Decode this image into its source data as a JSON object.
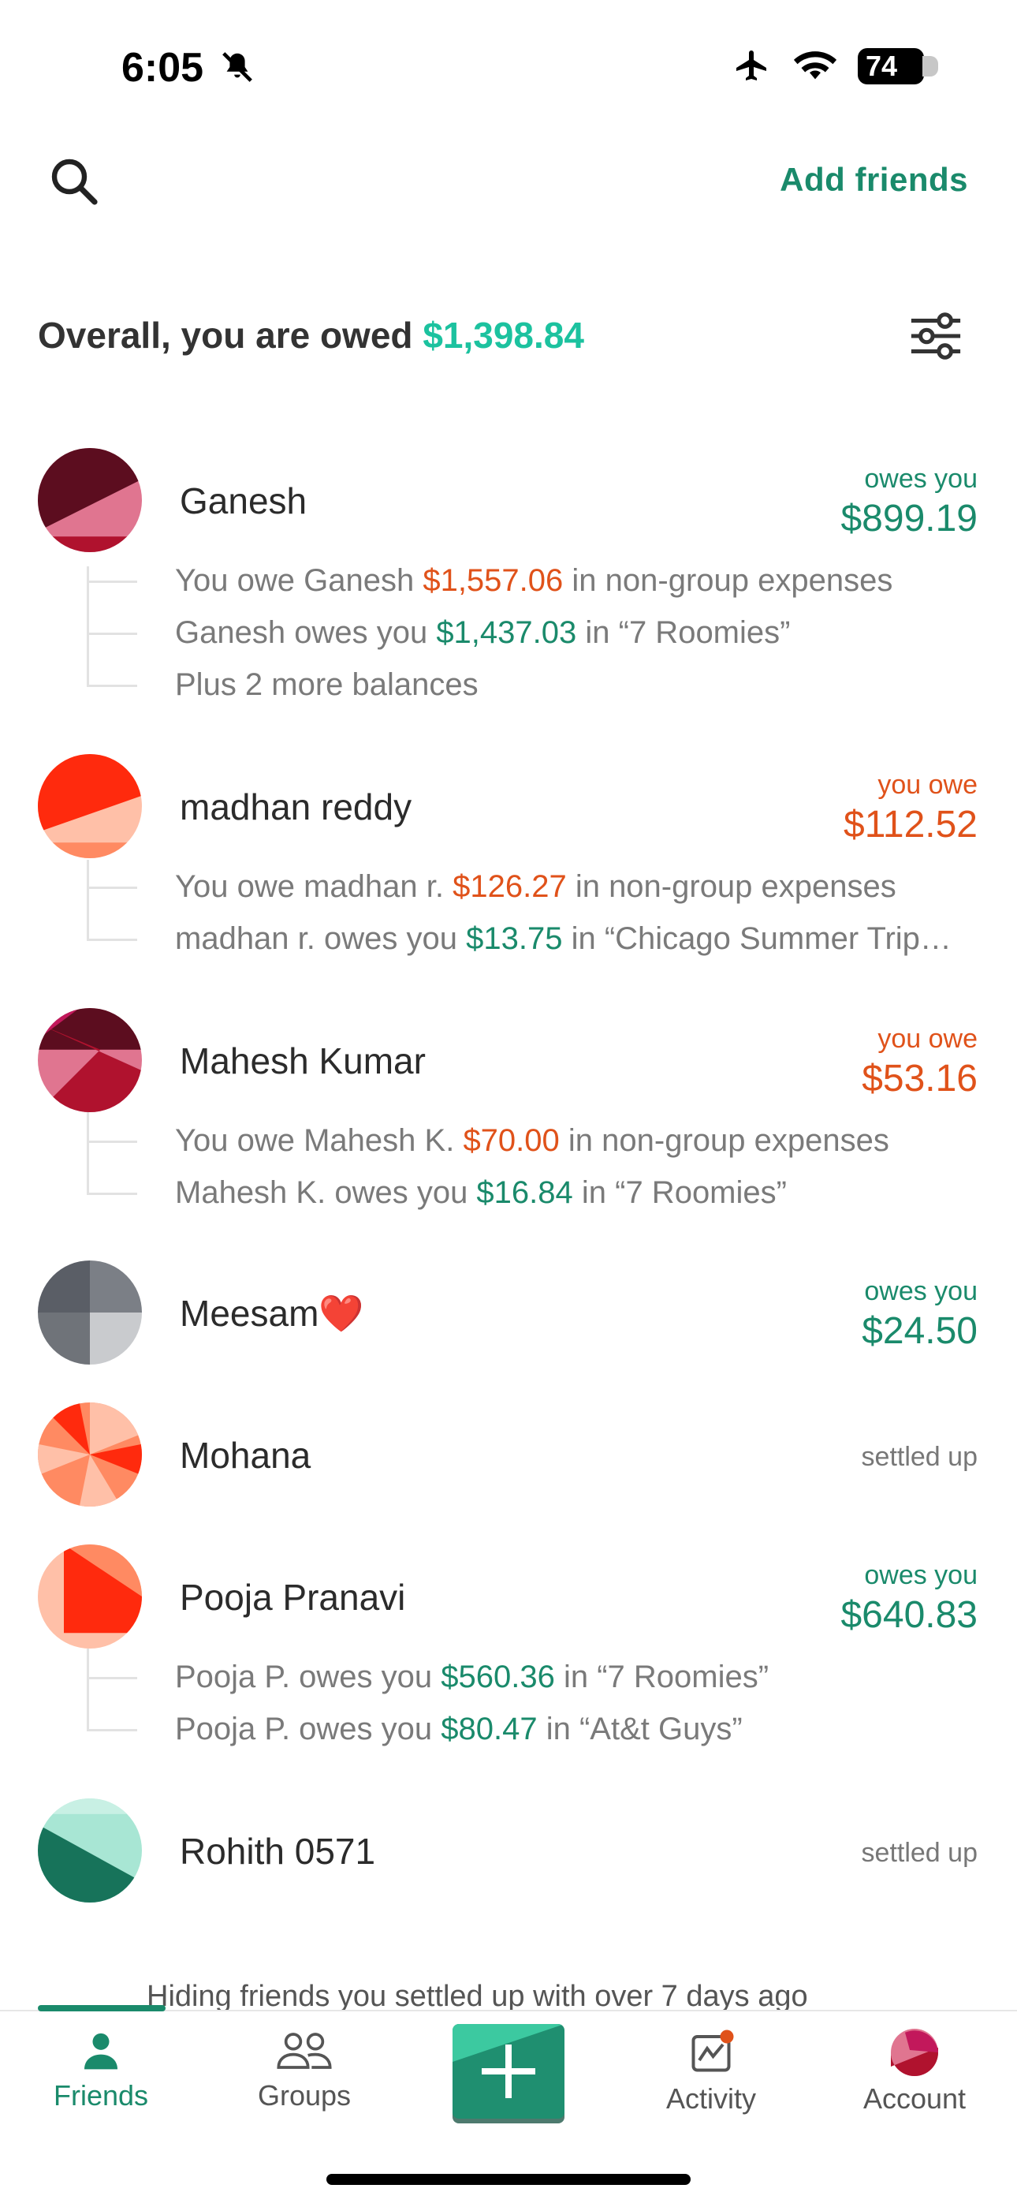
{
  "status_bar": {
    "time": "6:05",
    "battery": "74"
  },
  "header": {
    "add_friends": "Add friends"
  },
  "overall": {
    "prefix": "Overall, you are owed ",
    "amount": "$1,398.84"
  },
  "friends": [
    {
      "name": "Ganesh",
      "status": "owes you",
      "amount": "$899.19",
      "details": [
        {
          "pre": "You owe Ganesh ",
          "amt": "$1,557.06",
          "post": " in non-group expenses"
        },
        {
          "pre": "Ganesh owes you ",
          "amt": "$1,437.03",
          "post": " in “7 Roomies”"
        },
        {
          "text": "Plus 2 more balances"
        }
      ]
    },
    {
      "name": "madhan reddy",
      "status": "you owe",
      "amount": "$112.52",
      "details": [
        {
          "pre": "You owe madhan r. ",
          "amt": "$126.27",
          "post": " in non-group expenses"
        },
        {
          "pre": "madhan r. owes you ",
          "amt": "$13.75",
          "post": " in “Chicago Summer Trip…"
        }
      ]
    },
    {
      "name": "Mahesh Kumar",
      "status": "you owe",
      "amount": "$53.16",
      "details": [
        {
          "pre": "You owe Mahesh K. ",
          "amt": "$70.00",
          "post": " in non-group expenses"
        },
        {
          "pre": "Mahesh K. owes you ",
          "amt": "$16.84",
          "post": " in “7 Roomies”"
        }
      ]
    },
    {
      "name": "Meesam❤️",
      "status": "owes you",
      "amount": "$24.50"
    },
    {
      "name": "Mohana",
      "status": "settled up"
    },
    {
      "name": "Pooja Pranavi",
      "status": "owes you",
      "amount": "$640.83",
      "details": [
        {
          "pre": "Pooja P. owes you ",
          "amt": "$560.36",
          "post": " in “7 Roomies”"
        },
        {
          "pre": "Pooja P. owes you ",
          "amt": "$80.47",
          "post": " in “At&t Guys”"
        }
      ]
    },
    {
      "name": "Rohith 0571",
      "status": "settled up"
    }
  ],
  "hiding_note": "Hiding friends you settled up with over 7 days ago",
  "tabs": [
    {
      "label": "Friends",
      "icon": "person-icon"
    },
    {
      "label": "Groups",
      "icon": "group-icon"
    },
    {
      "label": "Activity",
      "icon": "activity-icon"
    },
    {
      "label": "Account",
      "icon": "avatar-icon"
    }
  ],
  "colors": {
    "accent": "#1a8a6b",
    "owed": "#1cc29f",
    "owe": "#e0521a"
  }
}
